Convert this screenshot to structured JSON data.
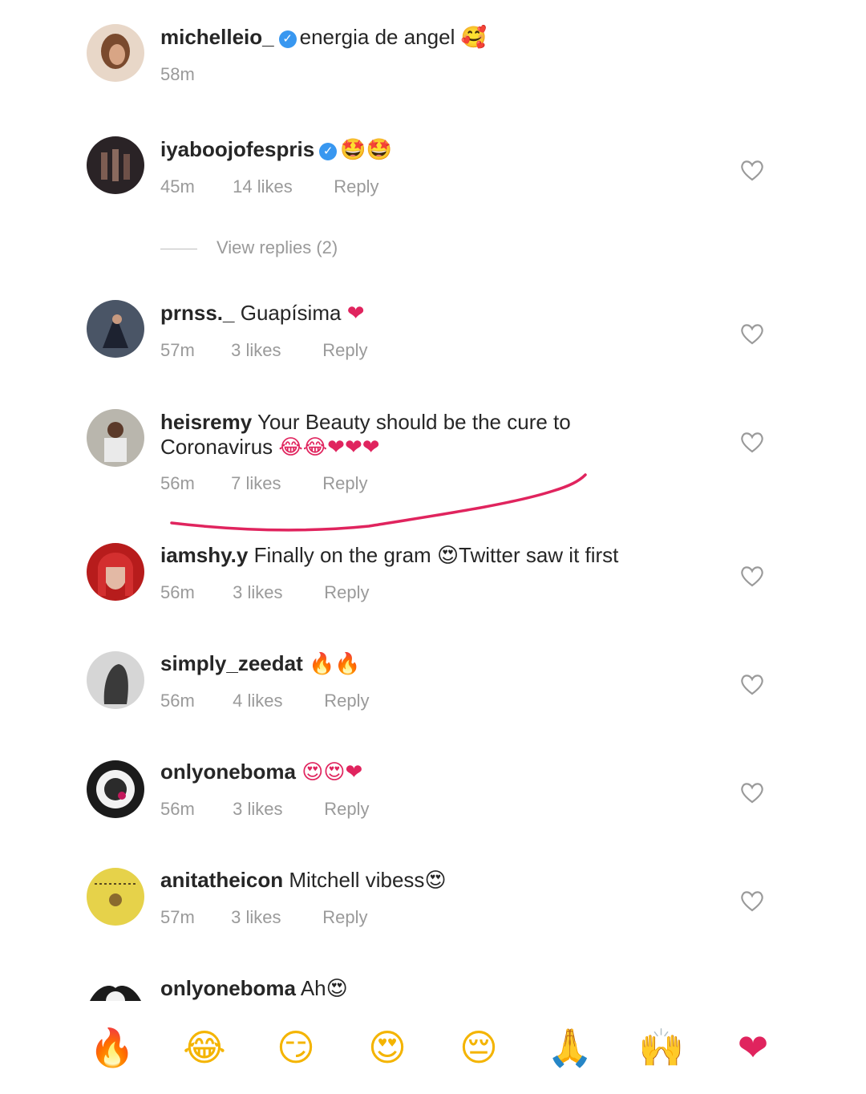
{
  "comments": [
    {
      "username": "michelleio_",
      "verified": true,
      "text": "energia de angel",
      "emoji": "🥰",
      "time": "58m",
      "likes": "",
      "reply": ""
    },
    {
      "username": "iyaboojofespris",
      "verified": true,
      "text": "",
      "emoji": "🤩🤩",
      "time": "45m",
      "likes": "14 likes",
      "reply": "Reply"
    },
    {
      "username": "prnss._",
      "verified": false,
      "text": "Guapísima",
      "emoji": "❤",
      "time": "57m",
      "likes": "3 likes",
      "reply": "Reply"
    },
    {
      "username": "heisremy",
      "verified": false,
      "text": "Your Beauty should be the cure to",
      "text2": "Coronavirus",
      "emoji": "😂😂❤❤❤",
      "time": "56m",
      "likes": "7 likes",
      "reply": "Reply"
    },
    {
      "username": "iamshy.y",
      "verified": false,
      "text": "Finally on the gram",
      "emoji": "😍",
      "text_after": "Twitter saw it first",
      "time": "56m",
      "likes": "3 likes",
      "reply": "Reply"
    },
    {
      "username": "simply_zeedat",
      "verified": false,
      "text": "",
      "emoji": "🔥🔥",
      "time": "56m",
      "likes": "4 likes",
      "reply": "Reply"
    },
    {
      "username": "onlyoneboma",
      "verified": false,
      "text": "",
      "emoji": "😍😍❤",
      "time": "56m",
      "likes": "3 likes",
      "reply": "Reply"
    },
    {
      "username": "anitatheicon",
      "verified": false,
      "text": "Mitchell vibess",
      "emoji": "😍",
      "time": "57m",
      "likes": "3 likes",
      "reply": "Reply"
    },
    {
      "username": "onlyoneboma",
      "verified": false,
      "text": "Ah",
      "emoji": "😍",
      "time": "",
      "likes": "",
      "reply": ""
    }
  ],
  "view_replies": "View replies (2)",
  "quick_emojis": [
    "🔥",
    "😂",
    "😏",
    "😍",
    "😔",
    "🙏",
    "🙌",
    "❤"
  ],
  "colors": {
    "heart_red": "#e0245e",
    "verified_blue": "#3897f0",
    "meta_gray": "#9a9a9a",
    "annotation_red": "#e0245e"
  }
}
